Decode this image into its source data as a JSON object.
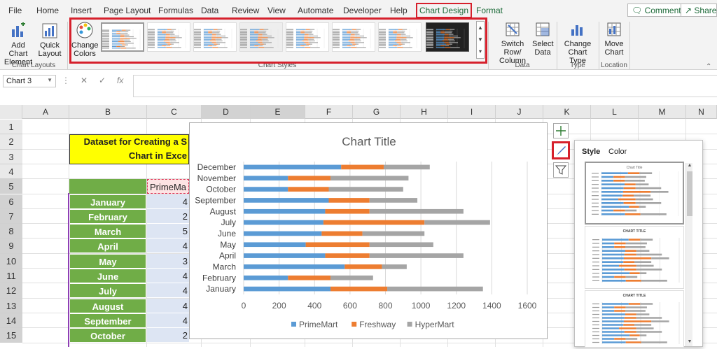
{
  "tabs": [
    "File",
    "Home",
    "Insert",
    "Page Layout",
    "Formulas",
    "Data",
    "Review",
    "View",
    "Automate",
    "Developer",
    "Help",
    "Chart Design",
    "Format"
  ],
  "top_buttons": {
    "comments": "Comments",
    "share": "Share"
  },
  "ribbon": {
    "add_chart_element": "Add Chart Element",
    "quick_layout": "Quick Layout",
    "change_colors": "Change Colors",
    "group_chart_layouts": "Chart Layouts",
    "group_chart_styles": "Chart Styles",
    "switch_row_column": "Switch Row/ Column",
    "select_data": "Select Data",
    "group_data": "Data",
    "change_chart_type": "Change Chart Type",
    "group_type": "Type",
    "move_chart": "Move Chart",
    "group_location": "Location"
  },
  "formula_bar": {
    "name_box": "Chart 3",
    "fx": "fx",
    "value": ""
  },
  "columns": [
    "A",
    "B",
    "C",
    "D",
    "E",
    "F",
    "G",
    "H",
    "I",
    "J",
    "K",
    "L",
    "M",
    "N"
  ],
  "rows": [
    "1",
    "2",
    "3",
    "4",
    "5",
    "6",
    "7",
    "8",
    "9",
    "10",
    "11",
    "12",
    "13",
    "14",
    "15"
  ],
  "sheet": {
    "title_line1": "Dataset for Creating a S",
    "title_line2": "Chart in Exce",
    "header_c5": "PrimeMa",
    "months": [
      "January",
      "February",
      "March",
      "April",
      "May",
      "June",
      "July",
      "August",
      "September",
      "October"
    ],
    "c_values": [
      "4",
      "2",
      "5",
      "4",
      "3",
      "4",
      "4",
      "4",
      "4",
      "2"
    ]
  },
  "chart_data": {
    "type": "bar",
    "stacked": true,
    "orientation": "horizontal",
    "title": "Chart Title",
    "categories": [
      "January",
      "February",
      "March",
      "April",
      "May",
      "June",
      "July",
      "August",
      "September",
      "October",
      "November",
      "December"
    ],
    "series": [
      {
        "name": "PrimeMart",
        "color": "#5b9bd5",
        "values": [
          490,
          250,
          570,
          460,
          350,
          440,
          450,
          460,
          480,
          250,
          250,
          550
        ]
      },
      {
        "name": "Freshway",
        "color": "#ed7d31",
        "values": [
          320,
          240,
          210,
          250,
          360,
          230,
          570,
          250,
          230,
          230,
          240,
          240
        ]
      },
      {
        "name": "HyperMart",
        "color": "#a5a5a5",
        "values": [
          540,
          240,
          140,
          530,
          360,
          350,
          370,
          530,
          270,
          420,
          440,
          260
        ]
      }
    ],
    "xlim": [
      0,
      1600
    ],
    "xticks": [
      "0",
      "200",
      "400",
      "600",
      "800",
      "1000",
      "1200",
      "1400",
      "1600"
    ],
    "grid": true,
    "legend": "bottom"
  },
  "style_pane": {
    "tab_style": "Style",
    "tab_color": "Color",
    "thumb1_title": "Chart Title",
    "thumb2_title": "CHART TITLE",
    "thumb3_title": "CHART TITLE"
  }
}
